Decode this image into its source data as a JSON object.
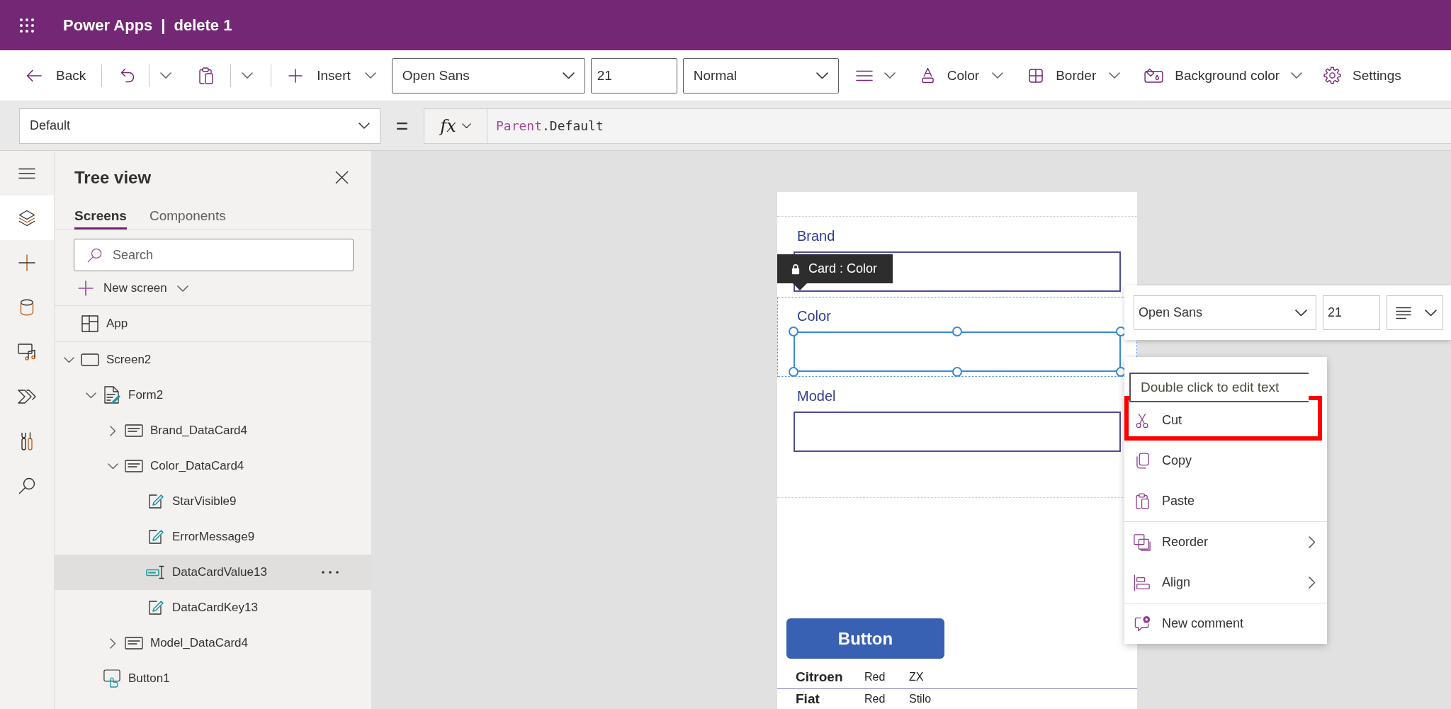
{
  "app_bar": {
    "product": "Power Apps",
    "separator": "|",
    "document": "delete 1"
  },
  "toolbar": {
    "back": "Back",
    "insert": "Insert",
    "font": "Open Sans",
    "font_size": "21",
    "text_style": "Normal",
    "font_color": "Color",
    "border": "Border",
    "fill": "Background color",
    "settings": "Settings"
  },
  "formula_bar": {
    "property": "Default",
    "equals": "=",
    "function_label": "fx",
    "formula": [
      {
        "kind": "keyword",
        "text": "Parent"
      },
      {
        "kind": "plain",
        "text": ".Default"
      }
    ]
  },
  "rail": {
    "items": [
      {
        "kind": "menu",
        "selected": false
      },
      {
        "kind": "layers",
        "selected": true
      },
      {
        "kind": "insert",
        "selected": false
      },
      {
        "kind": "data",
        "selected": false
      },
      {
        "kind": "media",
        "selected": false
      },
      {
        "kind": "automate",
        "selected": false
      },
      {
        "kind": "tools",
        "selected": false
      },
      {
        "kind": "search",
        "selected": false
      }
    ]
  },
  "tree_view": {
    "title": "Tree view",
    "tabs": [
      {
        "label": "Screens",
        "selected": true
      },
      {
        "label": "Components",
        "selected": false
      }
    ],
    "search": {
      "placeholder": "Search"
    },
    "new_screen": "New screen",
    "nodes": [
      {
        "kind": "app",
        "label": "App",
        "selected": false
      },
      {
        "kind": "screen",
        "label": "Screen2",
        "selected": false,
        "expanded": true,
        "children": [
          {
            "kind": "form",
            "label": "Form2",
            "selected": false,
            "expanded": true,
            "children": [
              {
                "kind": "card",
                "label": "Brand_DataCard4",
                "selected": false,
                "expanded": false
              },
              {
                "kind": "card",
                "label": "Color_DataCard4",
                "selected": false,
                "expanded": true,
                "children": [
                  {
                    "kind": "label",
                    "label": "StarVisible9",
                    "selected": false
                  },
                  {
                    "kind": "label",
                    "label": "ErrorMessage9",
                    "selected": false
                  },
                  {
                    "kind": "text_input",
                    "label": "DataCardValue13",
                    "selected": true
                  },
                  {
                    "kind": "label",
                    "label": "DataCardKey13",
                    "selected": false
                  }
                ]
              },
              {
                "kind": "card",
                "label": "Model_DataCard4",
                "selected": false,
                "expanded": false
              }
            ]
          },
          {
            "kind": "button",
            "label": "Button1",
            "selected": false
          }
        ]
      }
    ]
  },
  "canvas": {
    "selection_tooltip": "Card : Color",
    "form_cards": [
      {
        "label": "Brand",
        "selected": false
      },
      {
        "label": "Color",
        "selected": true
      },
      {
        "label": "Model",
        "selected": false
      }
    ],
    "button": "Button",
    "gallery_rows": [
      {
        "cells": [
          "Citroen",
          "Red",
          "ZX"
        ]
      },
      {
        "cells": [
          "Fiat",
          "Red",
          "Stilo"
        ]
      }
    ]
  },
  "floating_toolbar": {
    "font": "Open Sans",
    "font_size": "21"
  },
  "context_menu": {
    "hint": "Double click to edit text",
    "groups": [
      {
        "items": [
          {
            "kind": "cut",
            "label": "Cut",
            "submenu": false,
            "highlighted": true
          },
          {
            "kind": "copy",
            "label": "Copy",
            "submenu": false,
            "highlighted": false
          },
          {
            "kind": "paste",
            "label": "Paste",
            "submenu": false,
            "highlighted": false
          }
        ]
      },
      {
        "items": [
          {
            "kind": "reorder",
            "label": "Reorder",
            "submenu": true,
            "highlighted": false
          },
          {
            "kind": "align",
            "label": "Align",
            "submenu": true,
            "highlighted": false
          }
        ]
      },
      {
        "items": [
          {
            "kind": "comment",
            "label": "New comment",
            "submenu": false,
            "highlighted": false
          }
        ]
      }
    ]
  }
}
